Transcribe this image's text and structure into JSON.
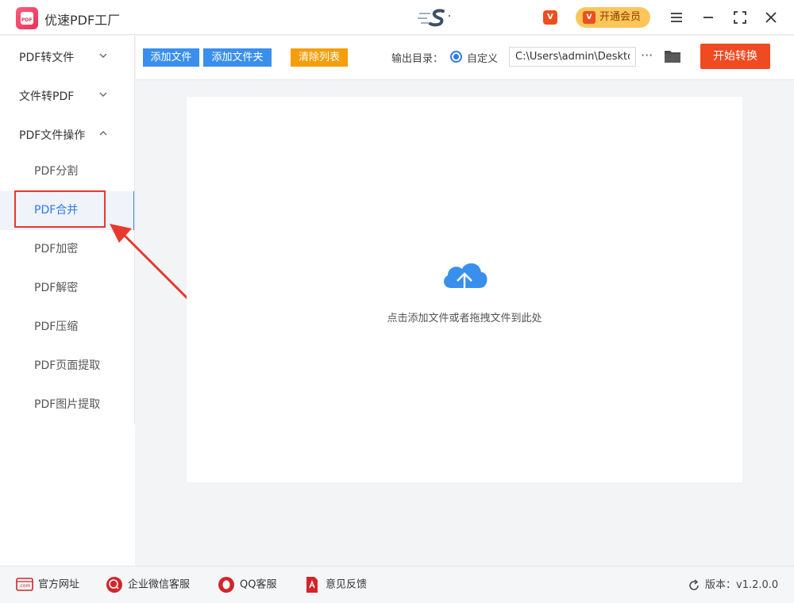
{
  "app": {
    "title": "优速PDF工厂",
    "logo_text": "PDF",
    "vip_small": "V",
    "vip_button": "开通会员",
    "vip_mark": "V"
  },
  "sidebar": {
    "groups": [
      {
        "label": "PDF转文件",
        "expanded": false
      },
      {
        "label": "文件转PDF",
        "expanded": false
      },
      {
        "label": "PDF文件操作",
        "expanded": true
      }
    ],
    "items": [
      {
        "label": "PDF分割",
        "active": false
      },
      {
        "label": "PDF合并",
        "active": true
      },
      {
        "label": "PDF加密",
        "active": false
      },
      {
        "label": "PDF解密",
        "active": false
      },
      {
        "label": "PDF压缩",
        "active": false
      },
      {
        "label": "PDF页面提取",
        "active": false
      },
      {
        "label": "PDF图片提取",
        "active": false
      }
    ]
  },
  "toolbar": {
    "add_file": "添加文件",
    "add_folder": "添加文件夹",
    "clear_list": "清除列表",
    "output_label": "输出目录：",
    "radio_label": "自定义",
    "output_path": "C:\\Users\\admin\\Desktop",
    "more": "···",
    "start": "开始转换"
  },
  "main": {
    "drop_hint": "点击添加文件或者拖拽文件到此处"
  },
  "footer": {
    "website": "官方网址",
    "website_icon_text": ".com",
    "wechat": "企业微信客服",
    "qq": "QQ客服",
    "feedback": "意见反馈",
    "version": "版本：v1.2.0.0"
  },
  "colors": {
    "accent_blue": "#3a8fed",
    "accent_orange": "#f59e0b",
    "start_red": "#ef4a21",
    "annotation_red": "#e8392f"
  }
}
